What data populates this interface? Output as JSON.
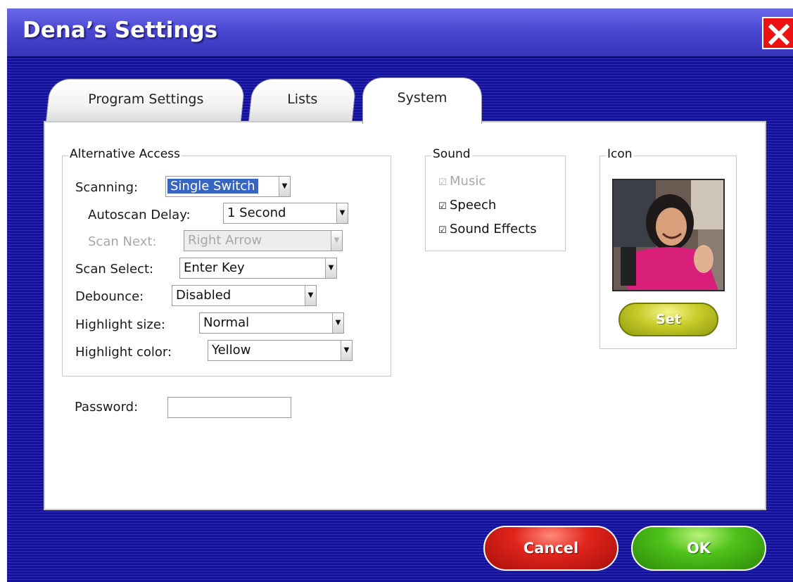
{
  "window": {
    "title": "Dena’s Settings",
    "close_icon": "close-x-icon"
  },
  "tabs": [
    {
      "label": "Program Settings",
      "active": false
    },
    {
      "label": "Lists",
      "active": false
    },
    {
      "label": "System",
      "active": true
    }
  ],
  "alternative_access": {
    "legend": "Alternative Access",
    "scanning": {
      "label": "Scanning:",
      "value": "Single Switch"
    },
    "autoscan_delay": {
      "label": "Autoscan Delay:",
      "value": "1 Second"
    },
    "scan_next": {
      "label": "Scan Next:",
      "value": "Right Arrow",
      "disabled": true
    },
    "scan_select": {
      "label": "Scan Select:",
      "value": "Enter Key"
    },
    "debounce": {
      "label": "Debounce:",
      "value": "Disabled"
    },
    "highlight_size": {
      "label": "Highlight size:",
      "value": "Normal"
    },
    "highlight_color": {
      "label": "Highlight color:",
      "value": "Yellow"
    }
  },
  "password": {
    "label": "Password:",
    "value": ""
  },
  "sound": {
    "legend": "Sound",
    "music": {
      "label": "Music",
      "checked": true,
      "disabled": true
    },
    "speech": {
      "label": "Speech",
      "checked": true
    },
    "sound_effects": {
      "label": "Sound Effects",
      "checked": true
    }
  },
  "icon": {
    "legend": "Icon",
    "set_label": "Set",
    "image": "user-photo"
  },
  "actions": {
    "cancel_label": "Cancel",
    "ok_label": "OK"
  },
  "colors": {
    "window_bg": "#14129a",
    "title_bar": "#4b49d2",
    "selection": "#3665c2",
    "cancel": "#e0241c",
    "ok": "#4fc21a",
    "set": "#c8cc2a",
    "close": "#ee1111"
  }
}
